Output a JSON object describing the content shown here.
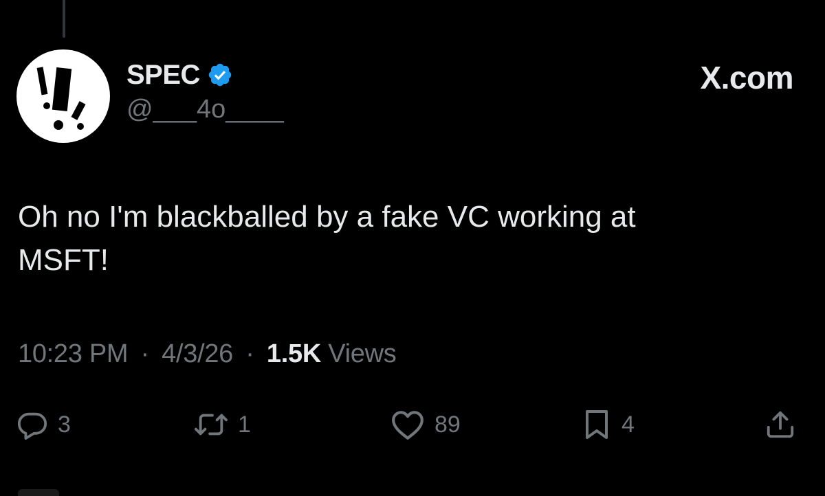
{
  "author": {
    "display_name": "SPEC",
    "handle": "@___4o____",
    "verified": true,
    "avatar_icon": "exclamation-logo-icon"
  },
  "site_label": "X.com",
  "tweet": {
    "text": "Oh no I'm blackballed by a fake VC working at\nMSFT!",
    "time": "10:23 PM",
    "separator": "·",
    "date": "4/3/26",
    "views_count": "1.5K",
    "views_label": "Views"
  },
  "actions": {
    "reply": {
      "icon": "reply-bubble-icon",
      "count": "3"
    },
    "retweet": {
      "icon": "retweet-arrows-icon",
      "count": "1"
    },
    "like": {
      "icon": "heart-icon",
      "count": "89"
    },
    "bookmark": {
      "icon": "bookmark-icon",
      "count": "4"
    },
    "share": {
      "icon": "share-upload-icon"
    }
  },
  "colors": {
    "background": "#000000",
    "primary_text": "#e7e9ea",
    "secondary_text": "#71767b",
    "verified_blue": "#1d9bf0"
  }
}
